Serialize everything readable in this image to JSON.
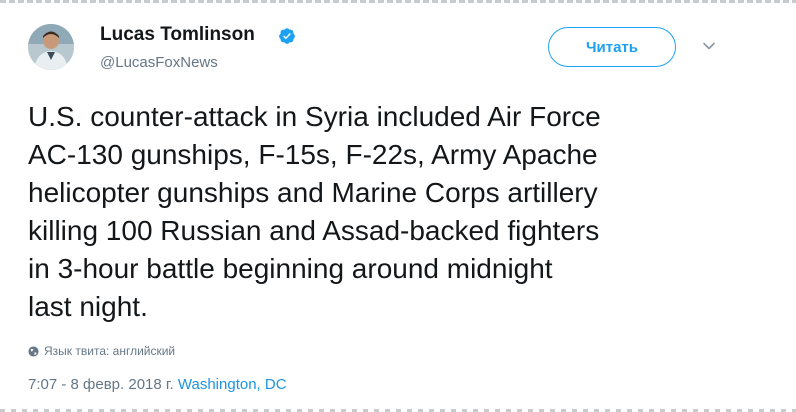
{
  "author": {
    "name": "Lucas Tomlinson",
    "handle": "@LucasFoxNews",
    "verified": true
  },
  "follow_button": {
    "label": "Читать"
  },
  "tweet": {
    "text": "U.S. counter-attack in Syria included Air Force\nAC-130 gunships, F-15s, F-22s, Army Apache\nhelicopter gunships and Marine Corps artillery\nkilling 100 Russian and Assad-backed fighters\nin 3-hour battle beginning around midnight\nlast night.",
    "translate_label": "Язык твита: английский",
    "timestamp": "7:07 - 8 февр. 2018 г.",
    "location": "Washington, DC"
  },
  "colors": {
    "accent": "#1da1f2",
    "link": "#1b95e0",
    "secondary_text": "#657786"
  },
  "icons": {
    "verified": "verified-badge-icon",
    "caret": "chevron-down-icon",
    "globe": "globe-icon"
  }
}
